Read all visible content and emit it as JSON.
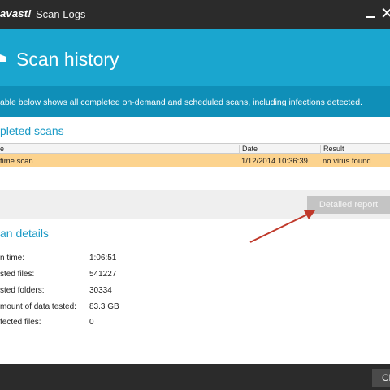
{
  "titlebar": {
    "brand": "avast!",
    "title": "Scan Logs",
    "minimize_icon": "minimize-icon",
    "close_icon": "close-icon",
    "close_glyph": "✕"
  },
  "header": {
    "title": "Scan history"
  },
  "description": "able below shows all completed on-demand and scheduled scans, including infections detected.",
  "completed_scans": {
    "title": "pleted scans",
    "columns": [
      "e",
      "Date",
      "Result"
    ],
    "rows": [
      {
        "name": "time scan",
        "date": "1/12/2014 10:36:39 ...",
        "result": "no virus found",
        "selected": true
      }
    ]
  },
  "toolbar": {
    "detailed_report_label": "Detailed report"
  },
  "scan_details": {
    "title": "an details",
    "items": [
      {
        "label": "n time:",
        "value": "1:06:51"
      },
      {
        "label": "sted files:",
        "value": "541227"
      },
      {
        "label": "sted folders:",
        "value": "30334"
      },
      {
        "label": "mount of data tested:",
        "value": "83.3 GB"
      },
      {
        "label": "fected files:",
        "value": "0"
      }
    ]
  },
  "footer": {
    "close_label": "Cl"
  },
  "colors": {
    "header_bg": "#1aa6cf",
    "desc_bg": "#0f8fb8",
    "selected_row": "#fcd38e",
    "section_title": "#1a9ac6",
    "arrow": "#c0392b"
  }
}
